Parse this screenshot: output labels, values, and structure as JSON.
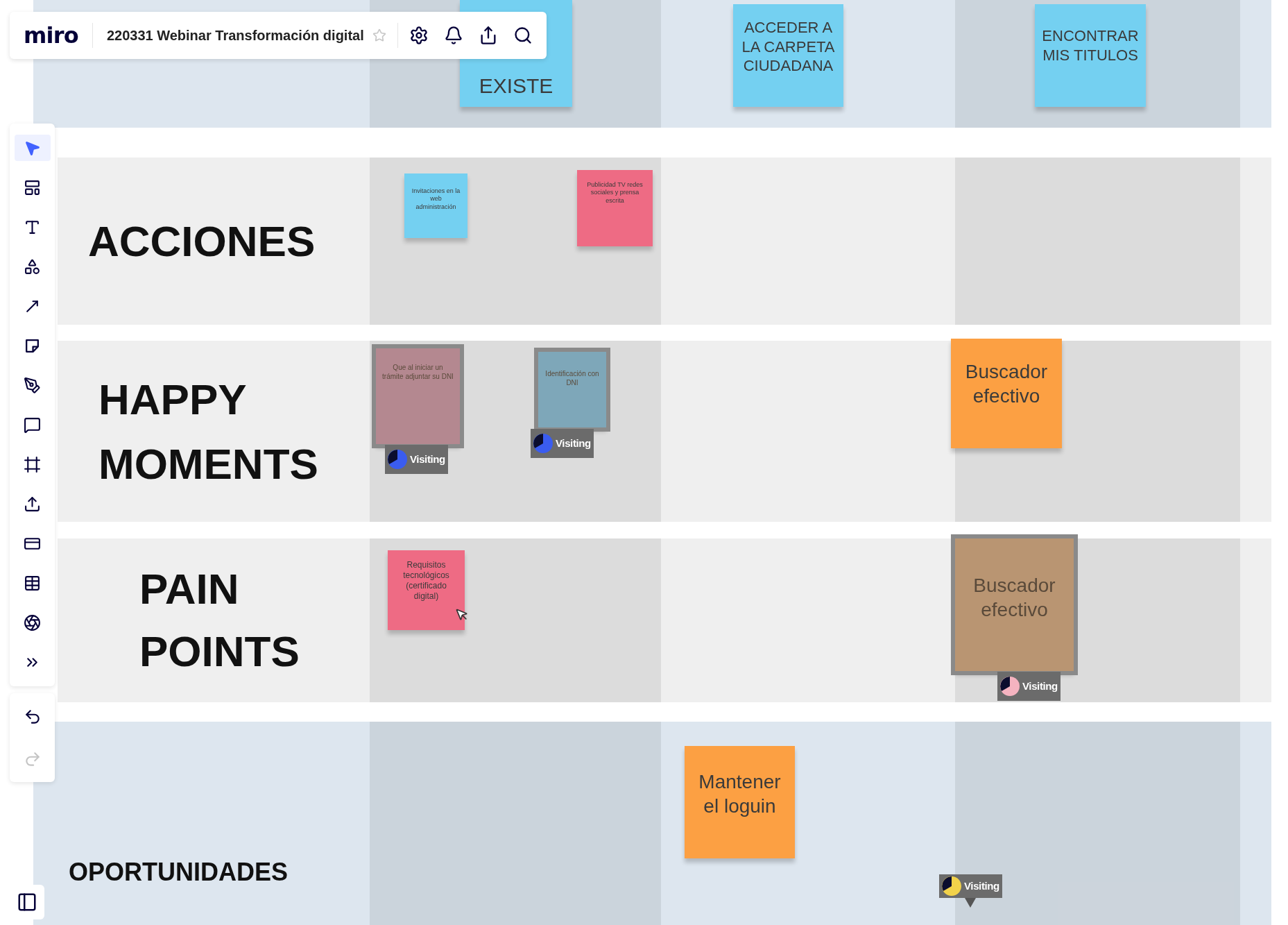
{
  "topbar": {
    "logo": "miro",
    "board_title": "220331 Webinar Transformación digital",
    "starred": false
  },
  "tools": [
    {
      "kind": "select",
      "selected": true
    },
    {
      "kind": "templates",
      "selected": false
    },
    {
      "kind": "text",
      "selected": false
    },
    {
      "kind": "shapes",
      "selected": false
    },
    {
      "kind": "arrow",
      "selected": false
    },
    {
      "kind": "sticky",
      "selected": false
    },
    {
      "kind": "pen",
      "selected": false
    },
    {
      "kind": "comment",
      "selected": false
    },
    {
      "kind": "frame",
      "selected": false
    },
    {
      "kind": "upload",
      "selected": false
    },
    {
      "kind": "card",
      "selected": false
    },
    {
      "kind": "table",
      "selected": false
    },
    {
      "kind": "apps",
      "selected": false
    },
    {
      "kind": "more",
      "selected": false
    }
  ],
  "history": [
    {
      "kind": "undo",
      "disabled": false
    },
    {
      "kind": "redo",
      "disabled": true
    }
  ],
  "rows": [
    {
      "color": "#dde6ef"
    },
    {
      "label": "ACCIONES",
      "color": "#efefef"
    },
    {
      "label": "HAPPY MOMENTS",
      "color": "#efefef"
    },
    {
      "label": "PAIN POINTS",
      "color": "#efefef"
    },
    {
      "label": "OPORTUNIDADES",
      "color": "#dde6ef"
    }
  ],
  "notes": [
    {
      "text": "EXISTE",
      "color": "#74d0f1"
    },
    {
      "text": "ACCEDER A LA CARPETA CIUDADANA",
      "color": "#74d0f1"
    },
    {
      "text": "ENCONTRAR MIS TITULOS",
      "color": "#74d0f1"
    },
    {
      "text": "Invitaciones en la web administración",
      "color": "#74d0f1"
    },
    {
      "text": "Publicidad TV redes sociales y prensa escrita",
      "color": "#ee6b84"
    },
    {
      "text": "Que al iniciar un trámite adjuntar su DNI",
      "color": "#b48890",
      "visitor": {
        "label": "Visiting",
        "color": "#3a5cf0"
      }
    },
    {
      "text": "Identificación con DNI",
      "color": "#7ea7b9",
      "visitor": {
        "label": "Visiting",
        "color": "#3a5cf0"
      }
    },
    {
      "text": "Buscador efectivo",
      "color": "#fca043"
    },
    {
      "text": "Buscador efectivo",
      "color": "#b99572",
      "visitor": {
        "label": "Visiting",
        "color": "#f5b3c0"
      }
    },
    {
      "text": "Requisitos tecnológicos (certificado digital)",
      "color": "#ee6b84"
    },
    {
      "text": "Mantener el loguin",
      "color": "#fca043"
    }
  ],
  "cursors": [
    {
      "label": "Visiting",
      "color": "#f2d24a"
    }
  ]
}
